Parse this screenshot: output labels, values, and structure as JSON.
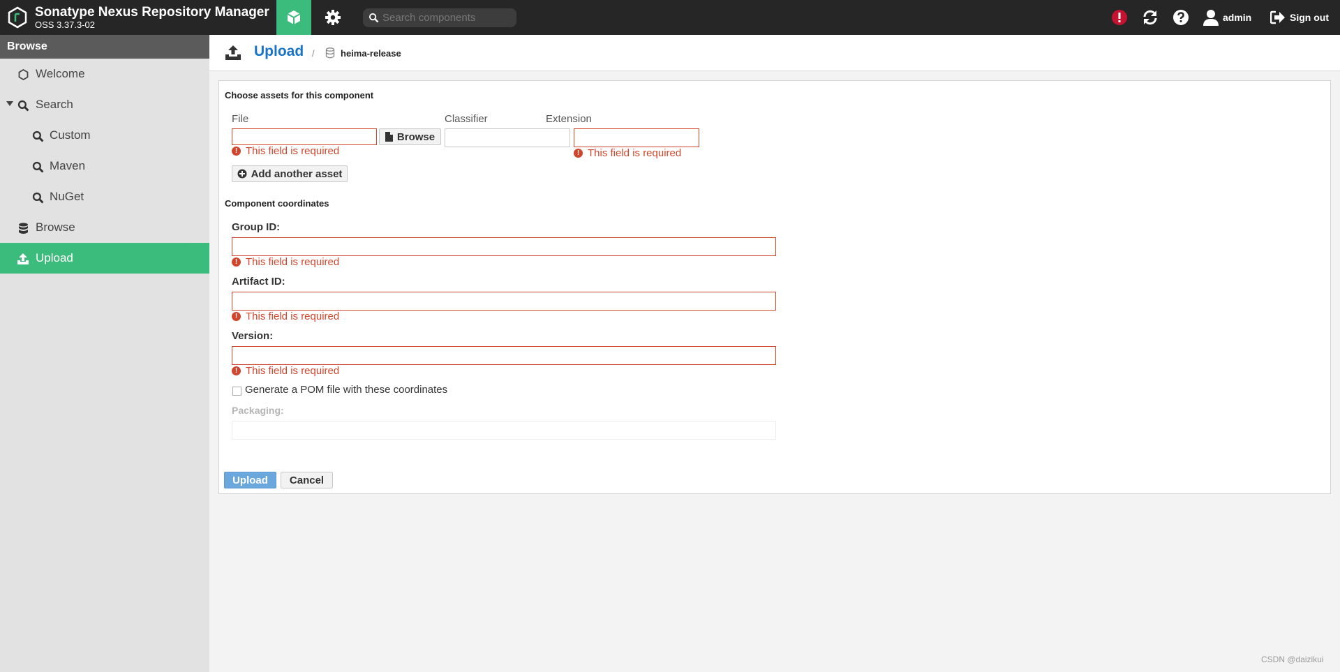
{
  "header": {
    "title": "Sonatype Nexus Repository Manager",
    "version": "OSS 3.37.3-02",
    "search_placeholder": "Search components",
    "user": "admin",
    "signout": "Sign out"
  },
  "sidebar": {
    "heading": "Browse",
    "items": [
      {
        "label": "Welcome"
      },
      {
        "label": "Search"
      },
      {
        "label": "Custom"
      },
      {
        "label": "Maven"
      },
      {
        "label": "NuGet"
      },
      {
        "label": "Browse"
      },
      {
        "label": "Upload"
      }
    ]
  },
  "breadcrumb": {
    "title": "Upload",
    "separator": "/",
    "repository": "heima-release"
  },
  "form": {
    "assets_title": "Choose assets for this component",
    "file_label": "File",
    "browse_label": "Browse",
    "classifier_label": "Classifier",
    "extension_label": "Extension",
    "add_asset_label": "Add another asset",
    "coordinates_title": "Component coordinates",
    "group_id_label": "Group ID:",
    "artifact_id_label": "Artifact ID:",
    "version_label": "Version:",
    "required_msg": "This field is required",
    "generate_pom_label": "Generate a POM file with these coordinates",
    "packaging_label": "Packaging:",
    "upload_button": "Upload",
    "cancel_button": "Cancel"
  },
  "colors": {
    "accent": "#3bbc7c",
    "link": "#1a73c8",
    "error": "#d0452c",
    "header_bg": "#262626"
  },
  "watermark": "CSDN @daizikui"
}
